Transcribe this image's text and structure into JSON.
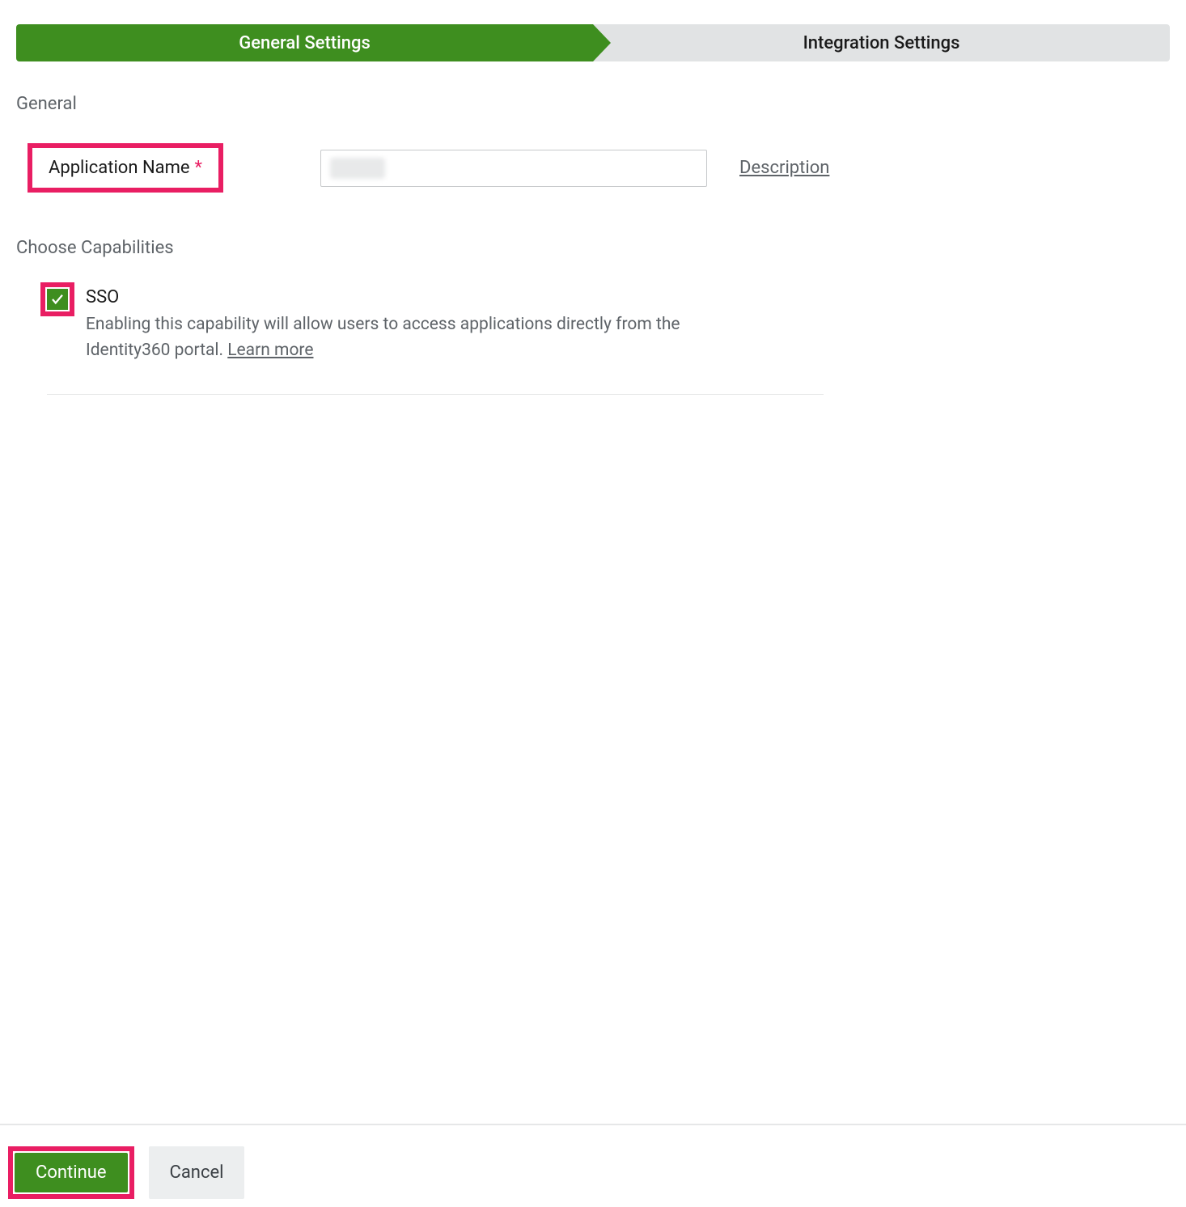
{
  "stepper": {
    "step1": "General Settings",
    "step2": "Integration Settings"
  },
  "sections": {
    "general_heading": "General",
    "capabilities_heading": "Choose Capabilities"
  },
  "form": {
    "app_name_label": "Application Name",
    "required_marker": "*",
    "description_link": "Description"
  },
  "capabilities": {
    "sso": {
      "title": "SSO",
      "description_part1": "Enabling this capability will allow users to access applications directly from the Identity360 portal. ",
      "learn_more": "Learn more"
    }
  },
  "buttons": {
    "continue": "Continue",
    "cancel": "Cancel"
  }
}
